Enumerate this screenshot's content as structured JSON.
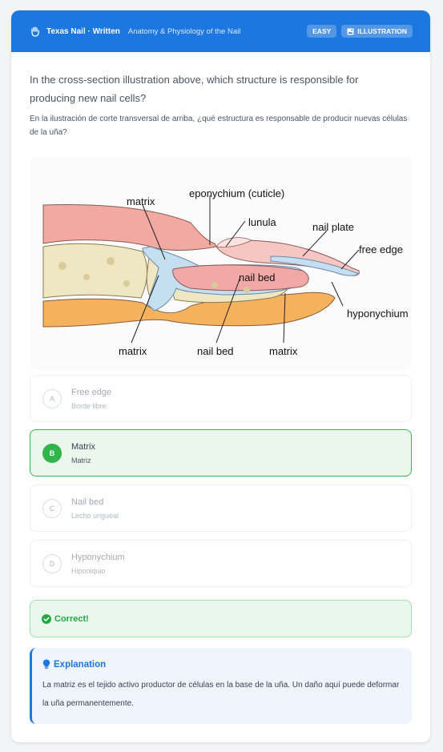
{
  "header": {
    "brand": "Texas Nail · Written",
    "topic": "Anatomy & Physiology of the Nail",
    "badge_difficulty": "EASY",
    "badge_type": "ILLUSTRATION",
    "icons": [
      "hand-icon",
      "image-icon"
    ]
  },
  "question": {
    "text_en": "In the cross-section illustration above, which structure is responsible for producing new nail cells?",
    "text_es": "En la ilustración de corte transversal de arriba, ¿qué estructura es responsable de producir nuevas células de la uña?"
  },
  "illustration": {
    "labels": {
      "matrix_top": "matrix",
      "eponychium": "eponychium  (cuticle)",
      "lunula": "lunula",
      "nail_plate": "nail plate",
      "free_edge": "free edge",
      "nail_bed_inner": "nail bed",
      "hyponychium": "hyponychium",
      "matrix_bottom_left": "matrix",
      "nail_bed_bottom": "nail bed",
      "matrix_bottom_right": "matrix"
    }
  },
  "options": [
    {
      "letter": "A",
      "label": "Free edge",
      "sub": "Borde libre",
      "state": "default"
    },
    {
      "letter": "B",
      "label": "Matrix",
      "sub": "Matriz",
      "state": "correct"
    },
    {
      "letter": "C",
      "label": "Nail bed",
      "sub": "Lecho ungueal",
      "state": "default"
    },
    {
      "letter": "D",
      "label": "Hyponychium",
      "sub": "Hiponiquio",
      "state": "default"
    }
  ],
  "feedback": {
    "text": "Correct!"
  },
  "explanation": {
    "title": "Explanation",
    "body": "La matriz es el tejido activo productor de células en la base de la uña. Un daño aquí puede deformar la uña permanentemente."
  },
  "colors": {
    "primary": "#1d77e0",
    "correct": "#2fb54a",
    "correct_bg": "#ebf7ed"
  }
}
